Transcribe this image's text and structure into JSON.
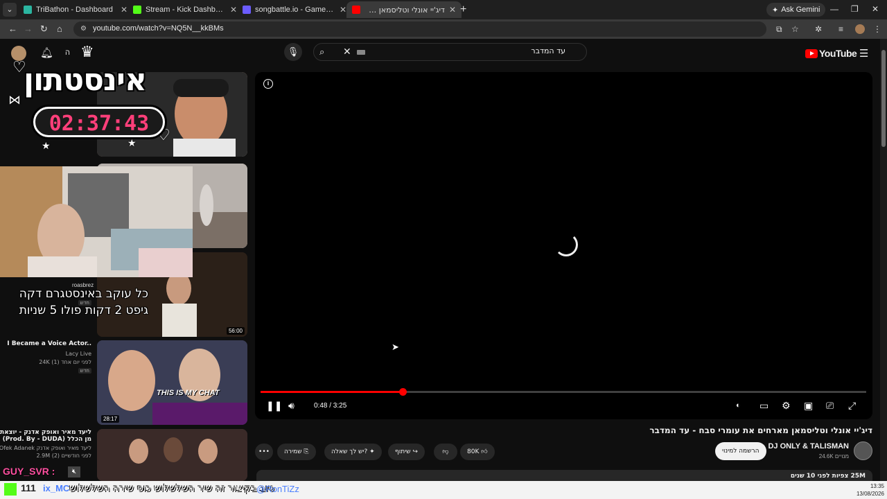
{
  "browser": {
    "tabs": [
      {
        "label": "TriBathon - Dashboard",
        "color": "#2bb5a0"
      },
      {
        "label": "Stream - Kick Dashboard",
        "color": "#53fc18"
      },
      {
        "label": "songbattle.io - Game URDXD",
        "color": "#6b5cff"
      },
      {
        "label": "דיג'יי אונלי וטליסמאן מארחים את",
        "color": "#ff0000"
      }
    ],
    "ask_gemini": "Ask Gemini",
    "url": "youtube.com/watch?v=NQ5N__kkBMs"
  },
  "yt": {
    "create_label": "ה",
    "search_value": "עד המדבר",
    "logo_text": "YouTube"
  },
  "player": {
    "time": "0:48 / 3:25",
    "progress_fraction": 0.234
  },
  "video": {
    "title": "דיג'יי אונלי וטליסמאן מארחים את עומרי סבח - עד המדבר",
    "channel": "DJ ONLY & TALISMAN",
    "subs": "24.6K מנויים",
    "subscribe": "הרשמה למינוי",
    "likes": "80K",
    "share": "שיתוף",
    "ask": "יש לך שאלה?",
    "save": "שמירה",
    "views_meta": "25M צפיות  לפני 10 שנים"
  },
  "recs": [
    {
      "title": "I Became a Voice Actor..",
      "channel": "Lacy Live",
      "meta": "24K  לפני יום אחד (1)",
      "badge": "חדש",
      "duration": ""
    },
    {
      "title": "",
      "channel": "roasbrez",
      "meta": "",
      "badge": "חדש",
      "duration": "56:00"
    },
    {
      "title": "ליעד מאיר ואופק אדנק - יוצאת מן הכלל (Prod. By - DUDA)",
      "channel": "Ofek Adanek ליעד מאיר ואופק אדנק",
      "meta": "2.9M  לפני חודשיים (2)",
      "badge": "",
      "duration": "28:17"
    }
  ],
  "overlay": {
    "brand": "אינסטתון",
    "timer": "02:37:43",
    "cam_name": "roasbrez",
    "chat_text": "כל עוקב באינסטגרם דקה גיפט 2 דקות פולו 5 שניות",
    "chat_on_thumb": "THIS IS MY CHAT",
    "guy": "GUY_SVR :",
    "ticker_count": "111",
    "ticker_user": "@RonTiZz",
    "ticker_text": "טוב בקיצור זה שיר השלשלוש כוס שירה השלשלוש",
    "ticker_left": "ix_MC",
    "clock_time": "13:35",
    "clock_date": "13/08/2026"
  },
  "colors": {
    "accent": "#ff0000",
    "timer": "#ff3f7a",
    "bg": "#0f0f0f"
  }
}
